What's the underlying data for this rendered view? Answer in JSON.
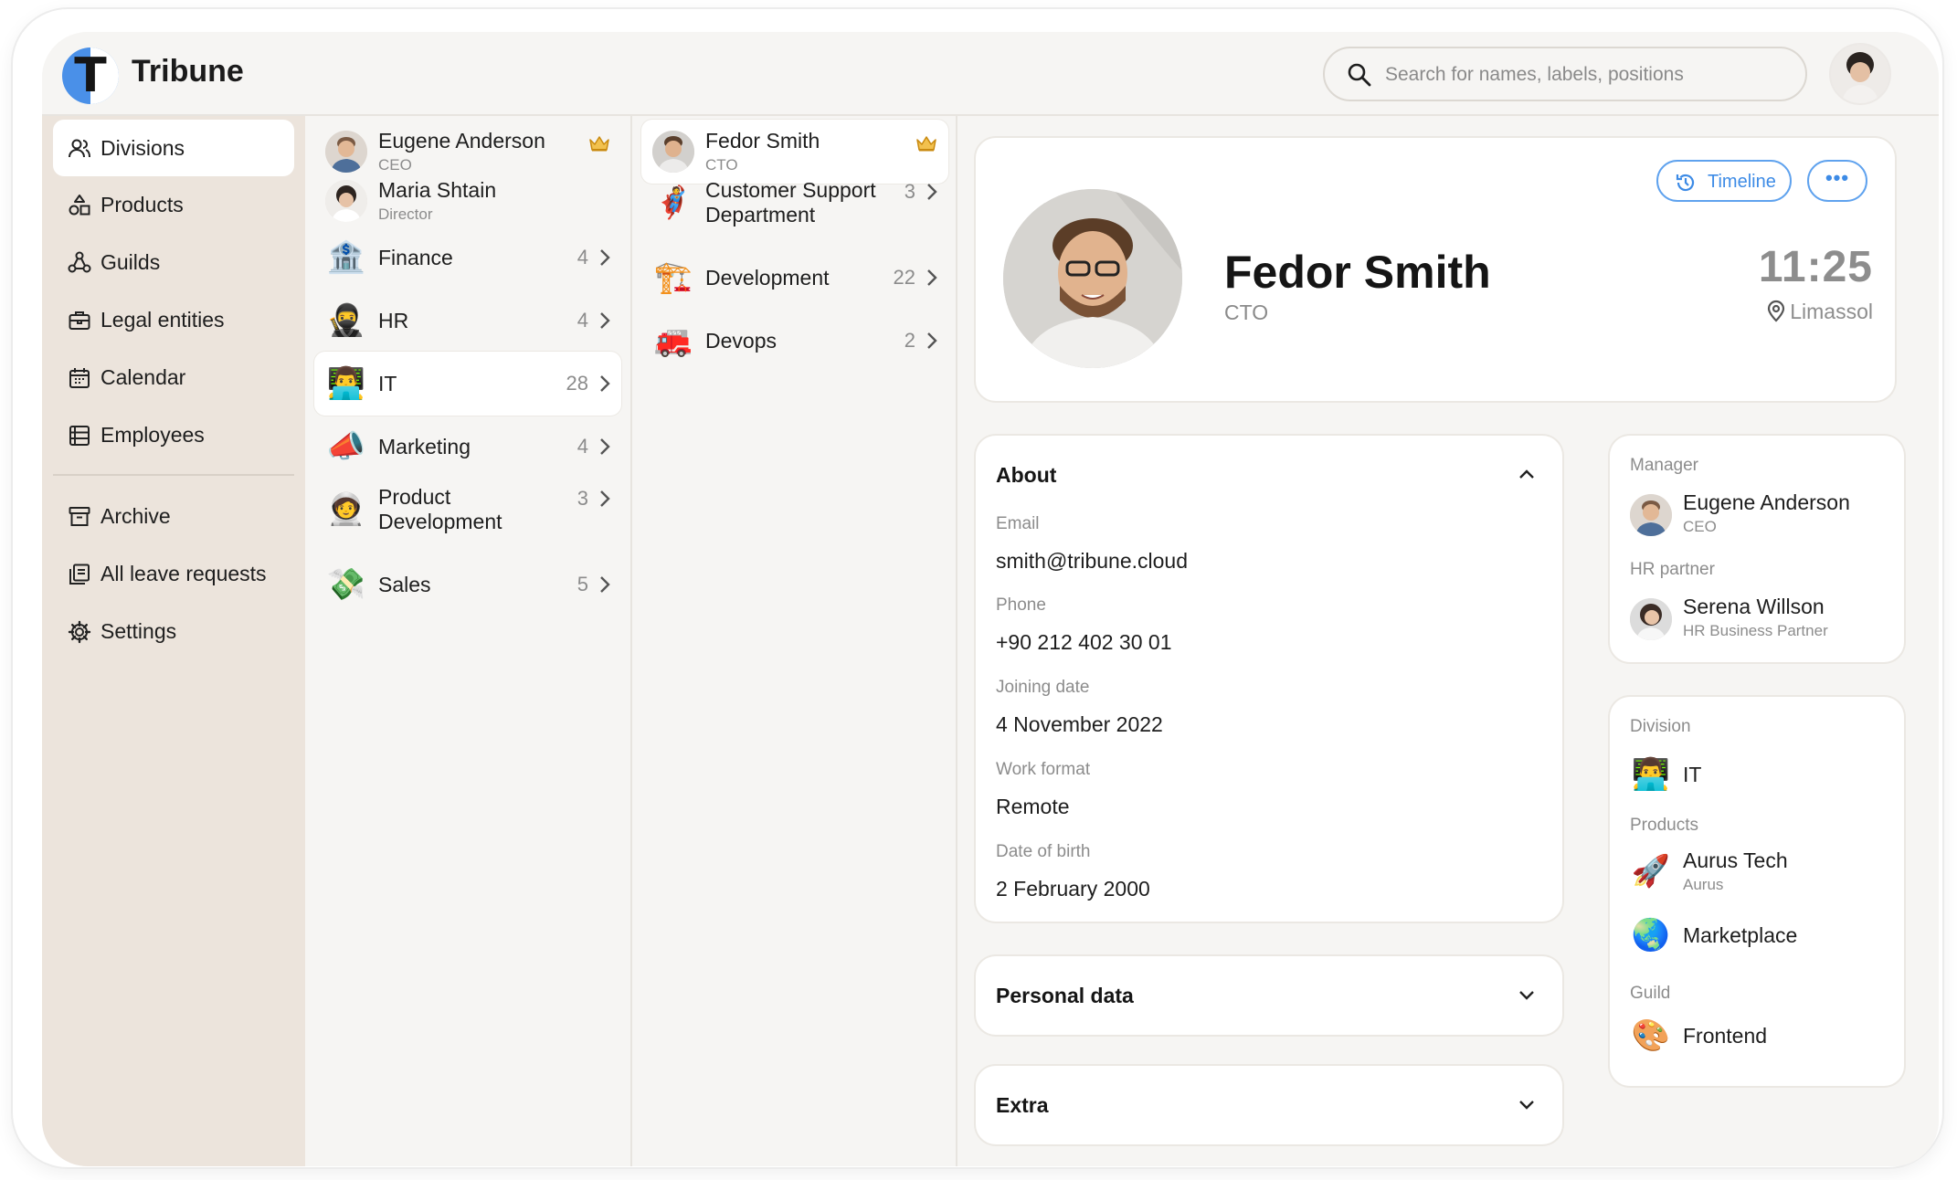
{
  "app": {
    "name": "Tribune"
  },
  "search": {
    "placeholder": "Search for names, labels, positions"
  },
  "sidebar": {
    "items": [
      {
        "label": "Divisions"
      },
      {
        "label": "Products"
      },
      {
        "label": "Guilds"
      },
      {
        "label": "Legal entities"
      },
      {
        "label": "Calendar"
      },
      {
        "label": "Employees"
      },
      {
        "label": "Archive"
      },
      {
        "label": "All leave requests"
      },
      {
        "label": "Settings"
      }
    ]
  },
  "column1": {
    "people": [
      {
        "name": "Eugene Anderson",
        "role": "CEO"
      },
      {
        "name": "Maria Shtain",
        "role": "Director"
      }
    ],
    "divisions": [
      {
        "name": "Finance",
        "count": "4",
        "icon": "🏦"
      },
      {
        "name": "HR",
        "count": "4",
        "icon": "🥷"
      },
      {
        "name": "IT",
        "count": "28",
        "icon": "👨‍💻"
      },
      {
        "name": "Marketing",
        "count": "4",
        "icon": "📣"
      },
      {
        "name": "Product Development",
        "count": "3",
        "icon": "🧑‍🚀"
      },
      {
        "name": "Sales",
        "count": "5",
        "icon": "💸"
      }
    ]
  },
  "column2": {
    "head": {
      "name": "Fedor Smith",
      "role": "CTO"
    },
    "teams": [
      {
        "name": "Customer Support Department",
        "count": "3",
        "icon": "🦸"
      },
      {
        "name": "Development",
        "count": "22",
        "icon": "🏗️"
      },
      {
        "name": "Devops",
        "count": "2",
        "icon": "🚒"
      }
    ]
  },
  "profile": {
    "name": "Fedor Smith",
    "role": "CTO",
    "time": "11:25",
    "location": "Limassol",
    "timeline_label": "Timeline",
    "more_label": "•••"
  },
  "about": {
    "title": "About",
    "fields": [
      {
        "label": "Email",
        "value": "smith@tribune.cloud"
      },
      {
        "label": "Phone",
        "value": "+90 212 402 30 01"
      },
      {
        "label": "Joining date",
        "value": "4 November 2022"
      },
      {
        "label": "Work format",
        "value": "Remote"
      },
      {
        "label": "Date of birth",
        "value": "2 February 2000"
      }
    ]
  },
  "personal_data": {
    "title": "Personal data"
  },
  "extra": {
    "title": "Extra"
  },
  "people_card": {
    "manager_label": "Manager",
    "manager": {
      "name": "Eugene Anderson",
      "role": "CEO"
    },
    "hr_label": "HR partner",
    "hr": {
      "name": "Serena Willson",
      "role": "HR Business Partner"
    }
  },
  "org_card": {
    "division_label": "Division",
    "division": {
      "name": "IT",
      "icon": "👨‍💻"
    },
    "products_label": "Products",
    "products": [
      {
        "name": "Aurus Tech",
        "sub": "Aurus",
        "icon": "🚀"
      },
      {
        "name": "Marketplace",
        "icon": "🌏"
      }
    ],
    "guild_label": "Guild",
    "guild": {
      "name": "Frontend",
      "icon": "🎨"
    }
  },
  "colors": {
    "accent": "#3d8be6",
    "sidebar_bg": "#ece4dc",
    "page_bg": "#f6f5f3",
    "crown": "#e0a020"
  }
}
